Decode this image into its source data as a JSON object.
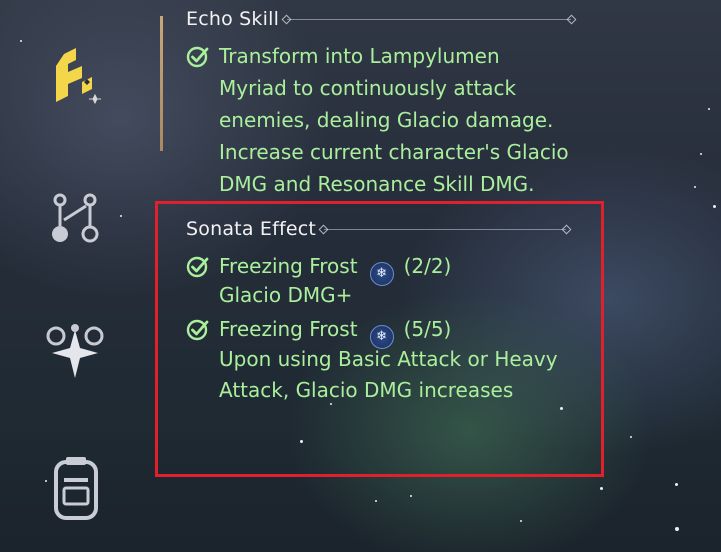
{
  "echo_skill": {
    "title": "Echo Skill",
    "lines": [
      "Transform into Lampylumen",
      "Myriad to continuously attack",
      "enemies, dealing Glacio damage.",
      "Increase current character's Glacio",
      "DMG and Resonance Skill DMG."
    ]
  },
  "sonata_effect": {
    "title": "Sonata Effect",
    "effects": [
      {
        "name": "Freezing Frost",
        "icon": "snowflake-icon",
        "count": "(2/2)",
        "description": [
          "Glacio DMG+"
        ]
      },
      {
        "name": "Freezing Frost",
        "icon": "snowflake-icon",
        "count": "(5/5)",
        "description": [
          "Upon using Basic Attack or Heavy",
          "Attack, Glacio DMG increases"
        ]
      }
    ]
  },
  "sidebar": {
    "icons": [
      "echo-skill-icon",
      "nodes-icon",
      "sonata-flower-icon",
      "device-icon"
    ]
  },
  "colors": {
    "effect_text": "#a9ef9c",
    "title_text": "#f2f2f2",
    "active_icon": "#f3d64a",
    "highlight_border": "#e0202a"
  }
}
